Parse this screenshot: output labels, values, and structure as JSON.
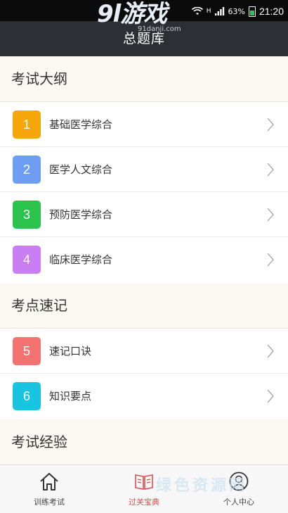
{
  "status_bar": {
    "battery": "63%",
    "time": "21:20",
    "network": "H"
  },
  "watermark_top": {
    "logo": "9l游戏",
    "domain": "91danji.com"
  },
  "header": {
    "title": "总题库"
  },
  "sections": [
    {
      "title": "考试大纲",
      "items": [
        {
          "number": "1",
          "label": "基础医学综合",
          "color": "#f5a60a"
        },
        {
          "number": "2",
          "label": "医学人文综合",
          "color": "#6e9ef3"
        },
        {
          "number": "3",
          "label": "预防医学综合",
          "color": "#2cc24e"
        },
        {
          "number": "4",
          "label": "临床医学综合",
          "color": "#c97ef3"
        }
      ]
    },
    {
      "title": "考点速记",
      "items": [
        {
          "number": "5",
          "label": "速记口诀",
          "color": "#f47272"
        },
        {
          "number": "6",
          "label": "知识要点",
          "color": "#19c4e0"
        }
      ]
    },
    {
      "title": "考试经验",
      "items": []
    }
  ],
  "tabs": [
    {
      "label": "训练考试",
      "icon": "home-icon"
    },
    {
      "label": "过关宝典",
      "icon": "book-icon"
    },
    {
      "label": "个人中心",
      "icon": "user-icon"
    }
  ],
  "watermark_bottom": {
    "text": "绿色资源网"
  },
  "colors": {
    "header_bg": "#2c2f33",
    "active_tab": "#d94f4f",
    "section_bg": "#fbf8f2"
  }
}
